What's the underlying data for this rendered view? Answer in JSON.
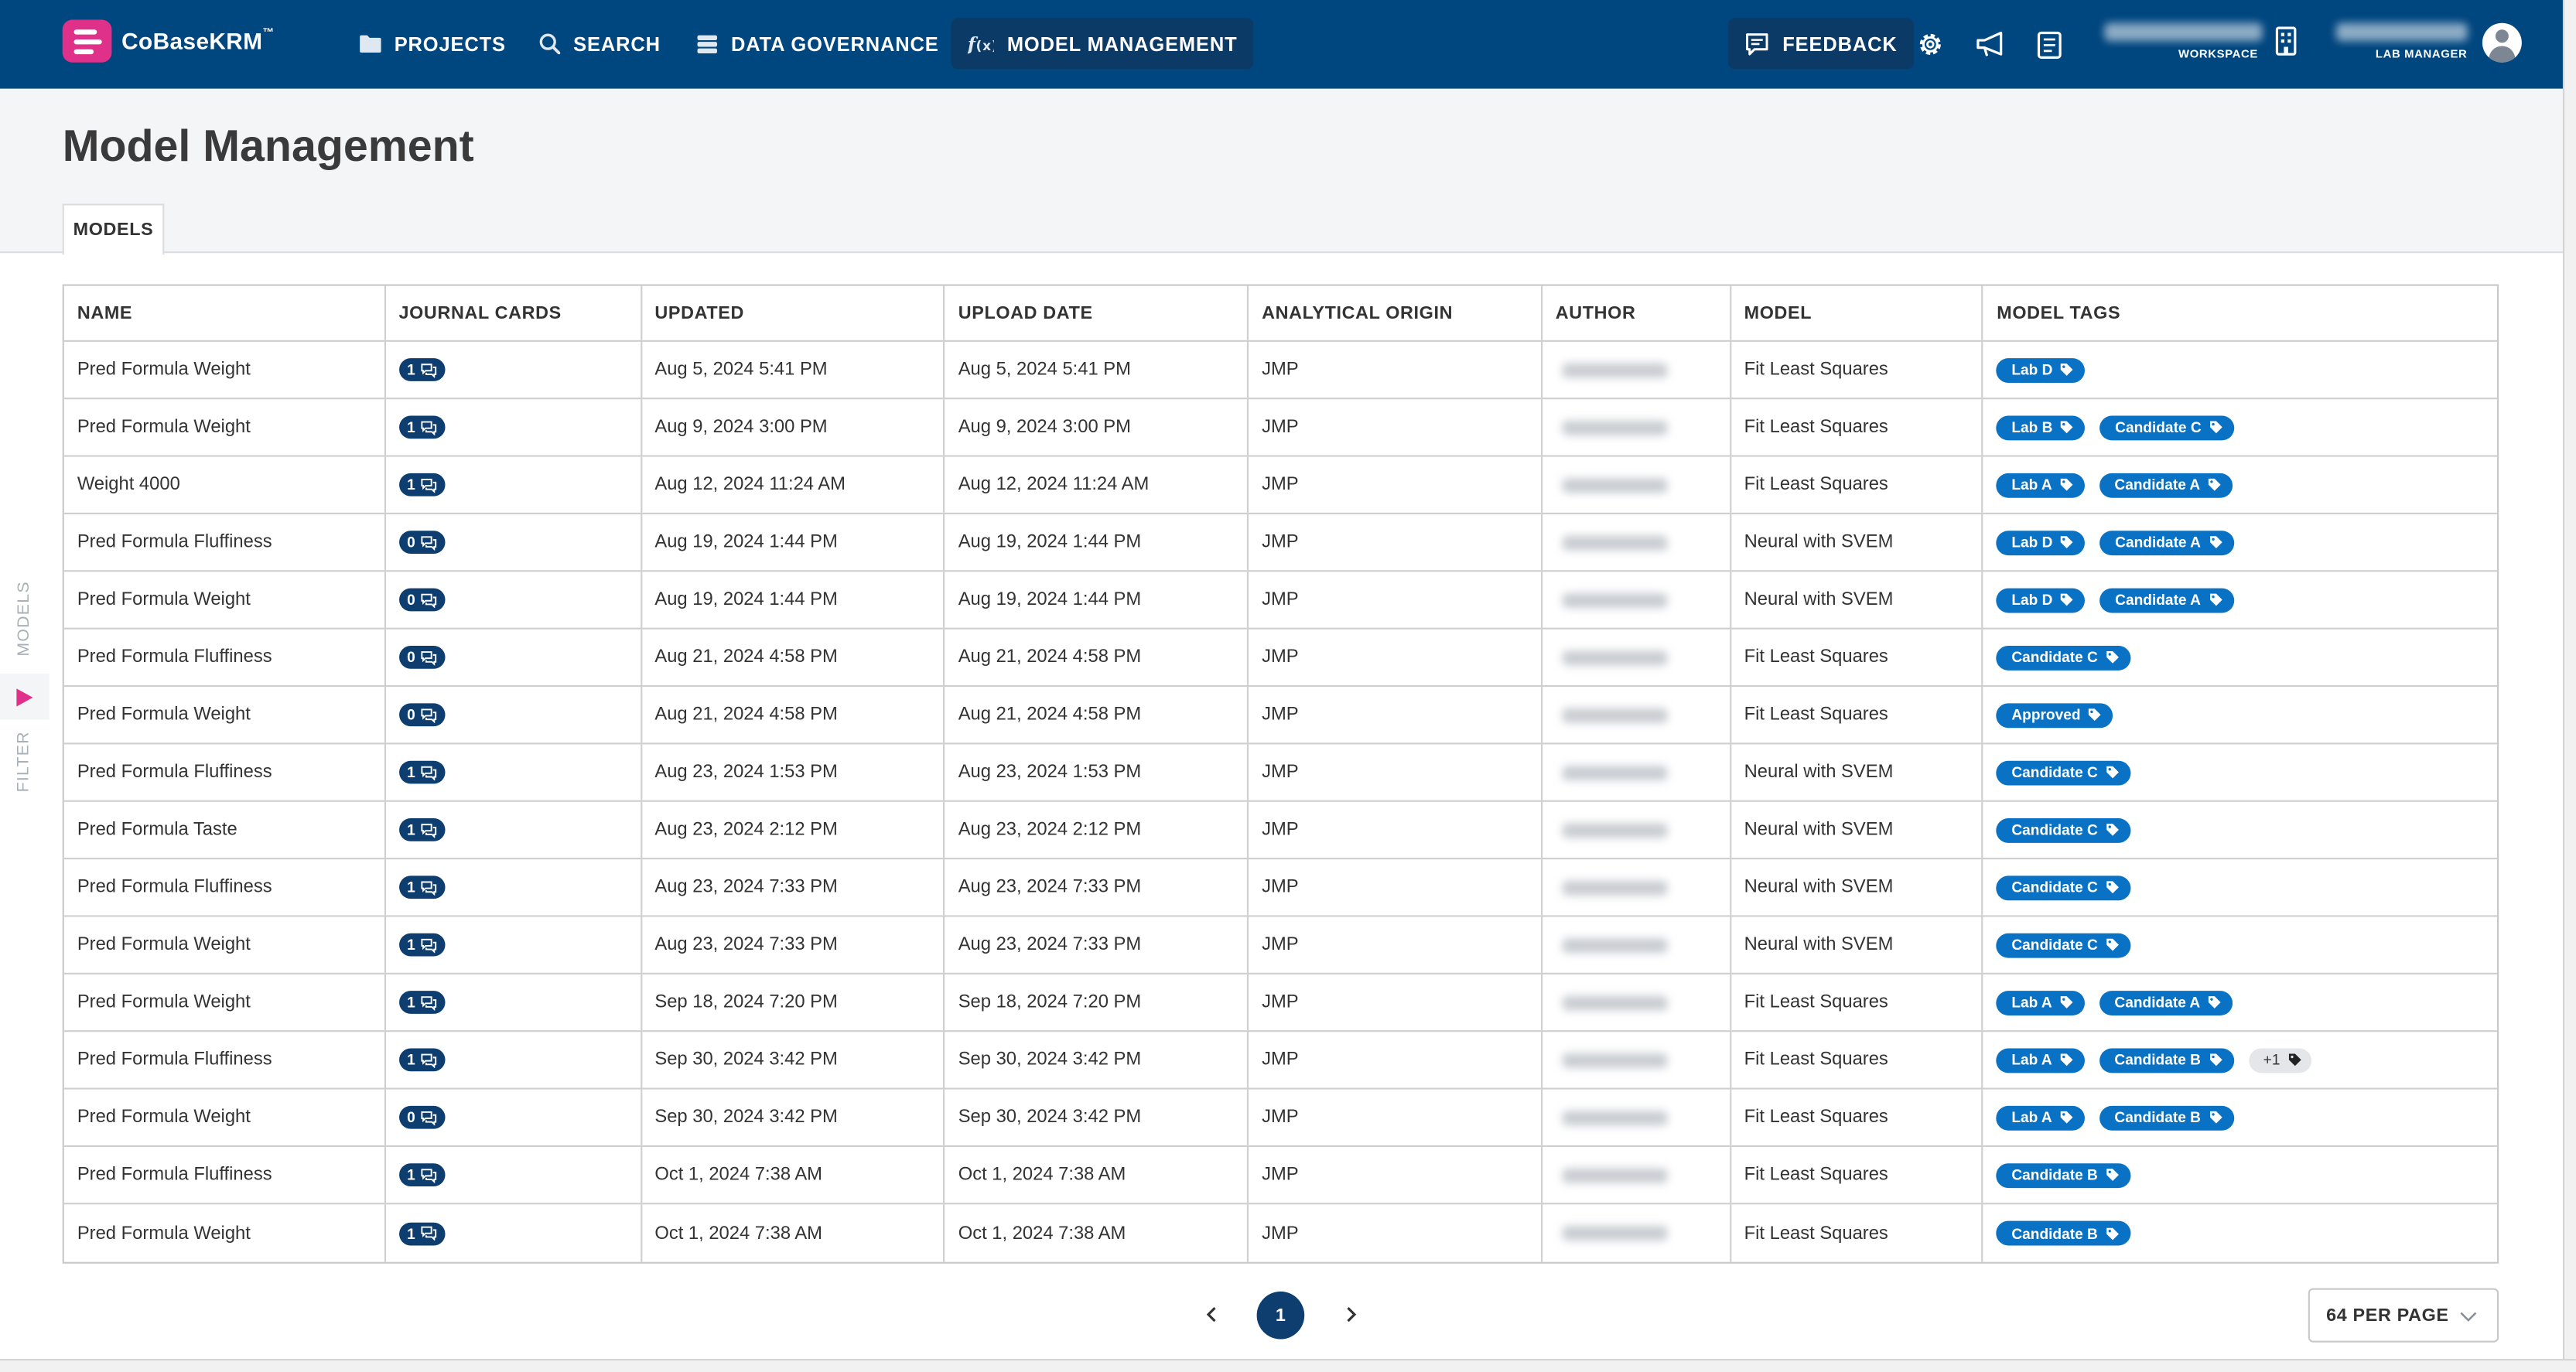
{
  "app": {
    "name": "CoBaseKRM",
    "tm": "™"
  },
  "nav": {
    "projects": "PROJECTS",
    "search": "SEARCH",
    "governance": "DATA GOVERNANCE",
    "models": "MODEL MANAGEMENT",
    "feedback": "FEEDBACK",
    "workspace_caption": "WORKSPACE",
    "role_caption": "LAB MANAGER"
  },
  "icons": {
    "projects": "folder-icon",
    "search": "search-icon",
    "governance": "database-icon",
    "models": "function-icon",
    "feedback": "chat-icon",
    "settings": "gear-icon",
    "announce": "megaphone-icon",
    "docs": "document-icon",
    "workspace": "building-icon",
    "user": "avatar-icon"
  },
  "page": {
    "title": "Model Management",
    "tab": "MODELS"
  },
  "rail": {
    "models": "MODELS",
    "filter": "FILTER"
  },
  "colors": {
    "nav_bg": "#00467f",
    "brand": "#e0318a",
    "tag": "#0a72c4",
    "badge": "#0d3e6f"
  },
  "table": {
    "headers": [
      "NAME",
      "JOURNAL CARDS",
      "UPDATED",
      "UPLOAD DATE",
      "ANALYTICAL ORIGIN",
      "AUTHOR",
      "MODEL",
      "MODEL TAGS"
    ],
    "rows": [
      {
        "name": "Pred Formula Weight",
        "cards": "1",
        "updated": "Aug 5, 2024 5:41 PM",
        "upload": "Aug 5, 2024 5:41 PM",
        "origin": "JMP",
        "model": "Fit Least Squares",
        "tags": [
          "Lab D"
        ]
      },
      {
        "name": "Pred Formula Weight",
        "cards": "1",
        "updated": "Aug 9, 2024 3:00 PM",
        "upload": "Aug 9, 2024 3:00 PM",
        "origin": "JMP",
        "model": "Fit Least Squares",
        "tags": [
          "Lab B",
          "Candidate C"
        ]
      },
      {
        "name": "Weight 4000",
        "cards": "1",
        "updated": "Aug 12, 2024 11:24 AM",
        "upload": "Aug 12, 2024 11:24 AM",
        "origin": "JMP",
        "model": "Fit Least Squares",
        "tags": [
          "Lab A",
          "Candidate A"
        ]
      },
      {
        "name": "Pred Formula Fluffiness",
        "cards": "0",
        "updated": "Aug 19, 2024 1:44 PM",
        "upload": "Aug 19, 2024 1:44 PM",
        "origin": "JMP",
        "model": "Neural with SVEM",
        "tags": [
          "Lab D",
          "Candidate A"
        ]
      },
      {
        "name": "Pred Formula Weight",
        "cards": "0",
        "updated": "Aug 19, 2024 1:44 PM",
        "upload": "Aug 19, 2024 1:44 PM",
        "origin": "JMP",
        "model": "Neural with SVEM",
        "tags": [
          "Lab D",
          "Candidate A"
        ]
      },
      {
        "name": "Pred Formula Fluffiness",
        "cards": "0",
        "updated": "Aug 21, 2024 4:58 PM",
        "upload": "Aug 21, 2024 4:58 PM",
        "origin": "JMP",
        "model": "Fit Least Squares",
        "tags": [
          "Candidate C"
        ]
      },
      {
        "name": "Pred Formula Weight",
        "cards": "0",
        "updated": "Aug 21, 2024 4:58 PM",
        "upload": "Aug 21, 2024 4:58 PM",
        "origin": "JMP",
        "model": "Fit Least Squares",
        "tags": [
          "Approved"
        ]
      },
      {
        "name": "Pred Formula Fluffiness",
        "cards": "1",
        "updated": "Aug 23, 2024 1:53 PM",
        "upload": "Aug 23, 2024 1:53 PM",
        "origin": "JMP",
        "model": "Neural with SVEM",
        "tags": [
          "Candidate C"
        ]
      },
      {
        "name": "Pred Formula Taste",
        "cards": "1",
        "updated": "Aug 23, 2024 2:12 PM",
        "upload": "Aug 23, 2024 2:12 PM",
        "origin": "JMP",
        "model": "Neural with SVEM",
        "tags": [
          "Candidate C"
        ]
      },
      {
        "name": "Pred Formula Fluffiness",
        "cards": "1",
        "updated": "Aug 23, 2024 7:33 PM",
        "upload": "Aug 23, 2024 7:33 PM",
        "origin": "JMP",
        "model": "Neural with SVEM",
        "tags": [
          "Candidate C"
        ]
      },
      {
        "name": "Pred Formula Weight",
        "cards": "1",
        "updated": "Aug 23, 2024 7:33 PM",
        "upload": "Aug 23, 2024 7:33 PM",
        "origin": "JMP",
        "model": "Neural with SVEM",
        "tags": [
          "Candidate C"
        ]
      },
      {
        "name": "Pred Formula Weight",
        "cards": "1",
        "updated": "Sep 18, 2024 7:20 PM",
        "upload": "Sep 18, 2024 7:20 PM",
        "origin": "JMP",
        "model": "Fit Least Squares",
        "tags": [
          "Lab A",
          "Candidate A"
        ]
      },
      {
        "name": "Pred Formula Fluffiness",
        "cards": "1",
        "updated": "Sep 30, 2024 3:42 PM",
        "upload": "Sep 30, 2024 3:42 PM",
        "origin": "JMP",
        "model": "Fit Least Squares",
        "tags": [
          "Lab A",
          "Candidate B"
        ],
        "more": "+1"
      },
      {
        "name": "Pred Formula Weight",
        "cards": "0",
        "updated": "Sep 30, 2024 3:42 PM",
        "upload": "Sep 30, 2024 3:42 PM",
        "origin": "JMP",
        "model": "Fit Least Squares",
        "tags": [
          "Lab A",
          "Candidate B"
        ]
      },
      {
        "name": "Pred Formula Fluffiness",
        "cards": "1",
        "updated": "Oct 1, 2024 7:38 AM",
        "upload": "Oct 1, 2024 7:38 AM",
        "origin": "JMP",
        "model": "Fit Least Squares",
        "tags": [
          "Candidate B"
        ]
      },
      {
        "name": "Pred Formula Weight",
        "cards": "1",
        "updated": "Oct 1, 2024 7:38 AM",
        "upload": "Oct 1, 2024 7:38 AM",
        "origin": "JMP",
        "model": "Fit Least Squares",
        "tags": [
          "Candidate B"
        ]
      }
    ]
  },
  "pagination": {
    "current": "1",
    "per_page": "64 PER PAGE"
  }
}
